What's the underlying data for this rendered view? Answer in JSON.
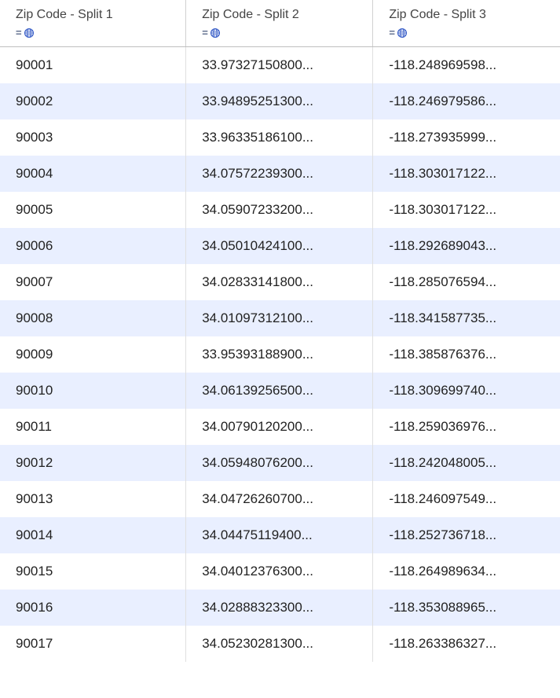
{
  "columns": [
    {
      "id": "zip",
      "label": "Zip Code - Split 1",
      "type_prefix": "=",
      "type_icon": "globe-icon"
    },
    {
      "id": "lat",
      "label": "Zip Code - Split 2",
      "type_prefix": "=",
      "type_icon": "globe-icon"
    },
    {
      "id": "lon",
      "label": "Zip Code - Split 3",
      "type_prefix": "=",
      "type_icon": "globe-icon"
    }
  ],
  "rows": [
    {
      "zip": "90001",
      "lat": "33.97327150800...",
      "lon": "-118.248969598..."
    },
    {
      "zip": "90002",
      "lat": "33.94895251300...",
      "lon": "-118.246979586..."
    },
    {
      "zip": "90003",
      "lat": "33.96335186100...",
      "lon": "-118.273935999..."
    },
    {
      "zip": "90004",
      "lat": "34.07572239300...",
      "lon": "-118.303017122..."
    },
    {
      "zip": "90005",
      "lat": "34.05907233200...",
      "lon": "-118.303017122..."
    },
    {
      "zip": "90006",
      "lat": "34.05010424100...",
      "lon": "-118.292689043..."
    },
    {
      "zip": "90007",
      "lat": "34.02833141800...",
      "lon": "-118.285076594..."
    },
    {
      "zip": "90008",
      "lat": "34.01097312100...",
      "lon": "-118.341587735..."
    },
    {
      "zip": "90009",
      "lat": "33.95393188900...",
      "lon": "-118.385876376..."
    },
    {
      "zip": "90010",
      "lat": "34.06139256500...",
      "lon": "-118.309699740..."
    },
    {
      "zip": "90011",
      "lat": "34.00790120200...",
      "lon": "-118.259036976..."
    },
    {
      "zip": "90012",
      "lat": "34.05948076200...",
      "lon": "-118.242048005..."
    },
    {
      "zip": "90013",
      "lat": "34.04726260700...",
      "lon": "-118.246097549..."
    },
    {
      "zip": "90014",
      "lat": "34.04475119400...",
      "lon": "-118.252736718..."
    },
    {
      "zip": "90015",
      "lat": "34.04012376300...",
      "lon": "-118.264989634..."
    },
    {
      "zip": "90016",
      "lat": "34.02888323300...",
      "lon": "-118.353088965..."
    },
    {
      "zip": "90017",
      "lat": "34.05230281300...",
      "lon": "-118.263386327..."
    }
  ]
}
